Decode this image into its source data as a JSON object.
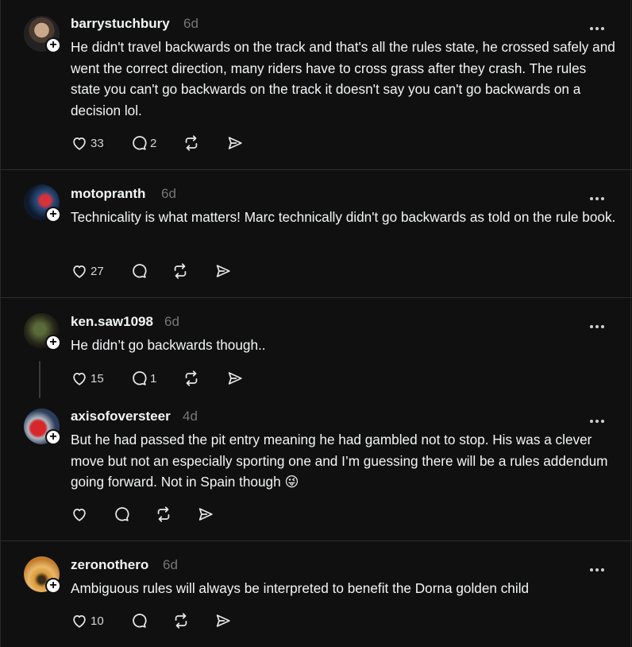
{
  "posts": [
    {
      "username": "barrystuchbury",
      "time": "6d",
      "text": "He didn't travel backwards on the track and that's all the rules state, he crossed safely and went the correct direction, many riders have to cross grass after they crash. The rules state you can't go backwards on the track it doesn't say you can't go backwards on a decision lol.",
      "likes": "33",
      "replies": "2"
    },
    {
      "username": "motopranth",
      "time": "6d",
      "text": "Technicality is what matters! Marc technically didn't go backwards as told on the rule book.",
      "likes": "27",
      "replies": ""
    },
    {
      "username": "ken.saw1098",
      "time": "6d",
      "text": "He didn’t go backwards though..",
      "likes": "15",
      "replies": "1"
    },
    {
      "username": "axisofoversteer",
      "time": "4d",
      "text": "But he had passed the pit entry meaning he had gambled not to stop. His was a clever move but not an especially sporting one and I’m guessing there will be a rules addendum going forward. Not in Spain though 😜",
      "likes": "",
      "replies": ""
    },
    {
      "username": "zeronothero",
      "time": "6d",
      "text": "Ambiguous rules will always be interpreted to benefit the Dorna golden child",
      "likes": "10",
      "replies": ""
    }
  ],
  "icons": {
    "like": "heart-icon",
    "reply": "comment-icon",
    "repost": "repost-icon",
    "share": "send-icon",
    "more": "more-options-icon",
    "follow": "plus-icon"
  },
  "colors": {
    "background": "#101010",
    "text": "#f3f5f7",
    "muted": "#777777",
    "divider": "#2e2e2e"
  }
}
